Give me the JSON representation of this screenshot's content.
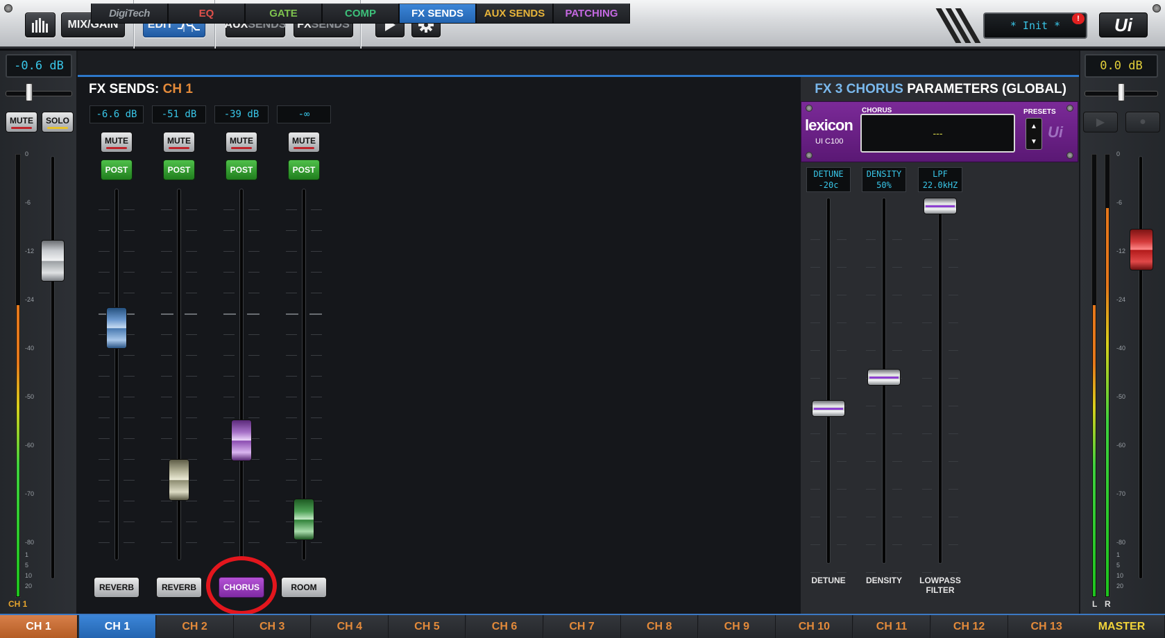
{
  "toolbar": {
    "mix_gain_label": "MIX/GAIN",
    "edit_label": "EDIT",
    "aux_sends": {
      "bright": "AUX",
      "dim": "SENDS"
    },
    "fx_sends": {
      "bright": "FX",
      "dim": "SENDS"
    },
    "snapshot_name": "* Init *",
    "alert": "!",
    "logo": "Ui"
  },
  "tabs": [
    {
      "label": "DigiTech",
      "color": "#9aa0a6"
    },
    {
      "label": "EQ",
      "color": "#e0504a"
    },
    {
      "label": "GATE",
      "color": "#7ec24e"
    },
    {
      "label": "COMP",
      "color": "#3dc07a"
    },
    {
      "label": "FX SENDS",
      "color": "#ffffff",
      "active": true
    },
    {
      "label": "AUX SENDS",
      "color": "#e7b43a"
    },
    {
      "label": "PATCHING",
      "color": "#c468e0"
    }
  ],
  "left_strip": {
    "gain": "-0.6 dB",
    "mute": "MUTE",
    "solo": "SOLO",
    "channel_label": "CH 1",
    "scale": [
      "0",
      "-6",
      "-12",
      "-24",
      "-40",
      "-50",
      "-60",
      "-70",
      "-80"
    ],
    "scale_low": [
      "1",
      "5",
      "10",
      "20"
    ],
    "fader_position": 0.22
  },
  "fx_sends": {
    "title": "FX SENDS:",
    "channel": "CH 1",
    "sends": [
      {
        "value": "-6.6 dB",
        "mute": "MUTE",
        "post": "POST",
        "name": "REVERB",
        "color": "blue",
        "position": 0.38
      },
      {
        "value": "-51 dB",
        "mute": "MUTE",
        "post": "POST",
        "name": "REVERB",
        "color": "khaki",
        "position": 0.84
      },
      {
        "value": "-39 dB",
        "mute": "MUTE",
        "post": "POST",
        "name": "CHORUS",
        "color": "purple",
        "position": 0.72,
        "selected": true
      },
      {
        "value": "-∞",
        "mute": "MUTE",
        "post": "POST",
        "name": "ROOM",
        "color": "green",
        "position": 0.96
      }
    ]
  },
  "fx_params": {
    "title_fx": "FX 3 CHORUS",
    "title_rest": "PARAMETERS (GLOBAL)",
    "unit_brand": "lexicon",
    "unit_model": "UI C100",
    "preset_label": "CHORUS",
    "preset_name": "---",
    "presets_label": "PRESETS",
    "unit_logo": "Ui",
    "params": [
      {
        "label": "DETUNE",
        "display_line1": "DETUNE",
        "display_line2": "-20c",
        "position": 0.58
      },
      {
        "label": "DENSITY",
        "display_line1": "DENSITY",
        "display_line2": "50%",
        "position": 0.49
      },
      {
        "label": "LOWPASS FILTER",
        "display_line1": "LPF",
        "display_line2": "22.0kHZ",
        "position": 0.0
      }
    ]
  },
  "master_strip": {
    "gain": "0.0 dB",
    "meter_l": "L",
    "meter_r": "R",
    "scale": [
      "0",
      "-6",
      "-12",
      "-24",
      "-40",
      "-50",
      "-60",
      "-70",
      "-80"
    ],
    "scale_low": [
      "1",
      "5",
      "10",
      "20"
    ],
    "fader_position": 0.19
  },
  "channel_bar": {
    "left": "CH 1",
    "channels": [
      "CH 1",
      "CH 2",
      "CH 3",
      "CH 4",
      "CH 5",
      "CH 6",
      "CH 7",
      "CH 8",
      "CH 9",
      "CH 10",
      "CH 11",
      "CH 12",
      "CH 13"
    ],
    "active": "CH 1",
    "master": "MASTER"
  }
}
